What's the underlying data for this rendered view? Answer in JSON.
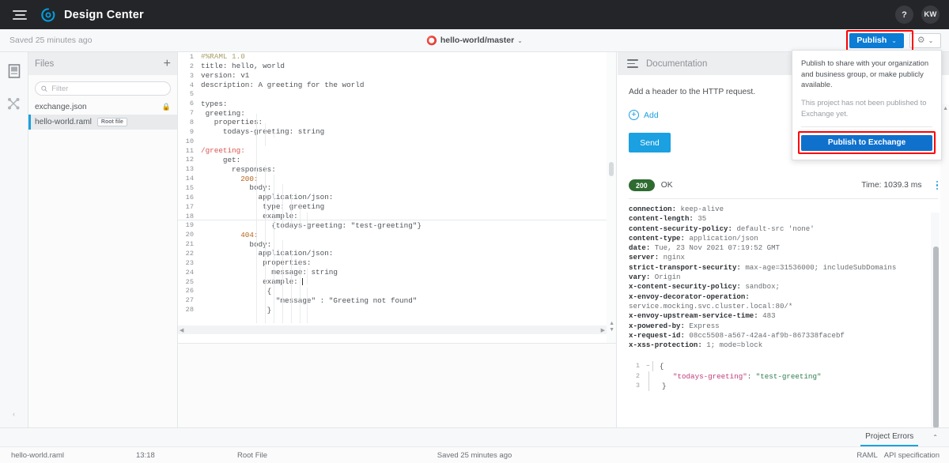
{
  "topnav": {
    "menu_icon": "hamburger-icon",
    "logo_icon": "mulesoft-logo-icon",
    "title": "Design Center",
    "help_label": "?",
    "avatar_label": "KW"
  },
  "toolbar": {
    "saved_text": "Saved 25 minutes ago",
    "branch_icon": "branch-icon",
    "branch_label": "hello-world/master",
    "branch_caret": "⌄",
    "publish_label": "Publish",
    "publish_caret": "⌄",
    "gear_icon": "gear-icon",
    "gear_caret": "⌄",
    "accent_blue": "#0c7cd5",
    "highlight_red": "#ff0000"
  },
  "publish_dropdown": {
    "description": "Publish to share with your organization and business group, or make publicly available.",
    "status_note": "This project has not been published to Exchange yet.",
    "button_label": "Publish to Exchange"
  },
  "rail": {
    "items": [
      {
        "icon": "files-panel-icon",
        "name": "project-files"
      },
      {
        "icon": "api-console-icon",
        "name": "mocking-service"
      }
    ],
    "collapse_label": "‹"
  },
  "files_panel": {
    "title": "Files",
    "add_label": "+",
    "filter_placeholder": "Filter",
    "filter_value": "",
    "search_icon": "search-icon",
    "items": [
      {
        "name": "exchange.json",
        "locked": true,
        "badge": "",
        "active": false
      },
      {
        "name": "hello-world.raml",
        "locked": false,
        "badge": "Root file",
        "active": true
      }
    ]
  },
  "editor": {
    "lines": [
      {
        "n": "1",
        "text": "#%RAML 1.0",
        "cls": "t-com",
        "indent": 0
      },
      {
        "n": "2",
        "text": "title: hello, world",
        "cls": "t-plain",
        "indent": 0
      },
      {
        "n": "3",
        "text": "version: v1",
        "cls": "t-plain",
        "indent": 0
      },
      {
        "n": "4",
        "text": "description: A greeting for the world",
        "cls": "t-plain",
        "indent": 0
      },
      {
        "n": "5",
        "text": "",
        "cls": "t-plain",
        "indent": 0
      },
      {
        "n": "6",
        "text": "types:",
        "cls": "t-plain",
        "indent": 0
      },
      {
        "n": "7",
        "text": " greeting:",
        "cls": "t-plain",
        "indent": 0
      },
      {
        "n": "8",
        "text": "   properties:",
        "cls": "t-plain",
        "indent": 0
      },
      {
        "n": "9",
        "text": "     todays-greeting: string",
        "cls": "t-plain",
        "indent": 0
      },
      {
        "n": "10",
        "text": "",
        "cls": "t-plain",
        "indent": 0
      },
      {
        "n": "11",
        "text": "/greeting:",
        "cls": "t-path",
        "indent": 0
      },
      {
        "n": "12",
        "text": "     get:",
        "cls": "t-plain",
        "indent": 0
      },
      {
        "n": "13",
        "text": "       responses:",
        "cls": "t-plain",
        "indent": 0
      },
      {
        "n": "14",
        "text": "         200:",
        "cls": "t-num",
        "indent": 0
      },
      {
        "n": "15",
        "text": "           body:",
        "cls": "t-plain",
        "indent": 0
      },
      {
        "n": "16",
        "text": "             application/json:",
        "cls": "t-plain",
        "indent": 0
      },
      {
        "n": "17",
        "text": "              type: greeting",
        "cls": "t-plain",
        "indent": 0
      },
      {
        "n": "18",
        "text": "              example:",
        "cls": "t-plain",
        "indent": 0
      },
      {
        "n": "19",
        "text": "                {todays-greeting: \"test-greeting\"}",
        "cls": "t-plain",
        "indent": 0
      },
      {
        "n": "20",
        "text": "         404:",
        "cls": "t-num",
        "indent": 0
      },
      {
        "n": "21",
        "text": "           body:",
        "cls": "t-plain",
        "indent": 0
      },
      {
        "n": "22",
        "text": "             application/json:",
        "cls": "t-plain",
        "indent": 0
      },
      {
        "n": "23",
        "text": "              properties:",
        "cls": "t-plain",
        "indent": 0
      },
      {
        "n": "24",
        "text": "                message: string",
        "cls": "t-plain",
        "indent": 0
      },
      {
        "n": "25",
        "text": "              example: ",
        "cls": "t-plain",
        "indent": 0
      },
      {
        "n": "26",
        "text": "               {",
        "cls": "t-plain",
        "indent": 0
      },
      {
        "n": "27",
        "text": "                 \"message\" : \"Greeting not found\"",
        "cls": "t-plain",
        "indent": 0
      },
      {
        "n": "28",
        "text": "               }",
        "cls": "t-plain",
        "indent": 0
      }
    ],
    "overflow_dots": "• • •"
  },
  "right_panel": {
    "title": "Documentation",
    "header_note": "Add a header to the HTTP request.",
    "add_label": "Add",
    "send_label": "Send",
    "status_code": "200",
    "status_text": "OK",
    "time_label": "Time: 1039.3 ms",
    "response_headers": [
      {
        "key": "connection:",
        "value": "keep-alive"
      },
      {
        "key": "content-length:",
        "value": "35"
      },
      {
        "key": "content-security-policy:",
        "value": "default-src 'none'"
      },
      {
        "key": "content-type:",
        "value": "application/json"
      },
      {
        "key": "date:",
        "value": "Tue, 23 Nov 2021 07:19:52 GMT"
      },
      {
        "key": "server:",
        "value": "nginx"
      },
      {
        "key": "strict-transport-security:",
        "value": "max-age=31536000; includeSubDomains"
      },
      {
        "key": "vary:",
        "value": "Origin"
      },
      {
        "key": "x-content-security-policy:",
        "value": "sandbox;"
      },
      {
        "key": "x-envoy-decorator-operation:",
        "value": ""
      },
      {
        "key": "",
        "value": "service.mocking.svc.cluster.local:80/*"
      },
      {
        "key": "x-envoy-upstream-service-time:",
        "value": "483"
      },
      {
        "key": "x-powered-by:",
        "value": "Express"
      },
      {
        "key": "x-request-id:",
        "value": "08cc5508-a567-42a4-af9b-867338facebf"
      },
      {
        "key": "x-xss-protection:",
        "value": "1; mode=block"
      }
    ],
    "response_body": [
      {
        "n": "1",
        "fold": "−",
        "text": "{",
        "type": "brace"
      },
      {
        "n": "2",
        "fold": "",
        "key": "\"todays-greeting\"",
        "sep": ": ",
        "val": "\"test-greeting\"",
        "type": "pair"
      },
      {
        "n": "3",
        "fold": "",
        "text": "}",
        "type": "brace"
      }
    ],
    "expand_icon": "chevron-right-icon"
  },
  "errorbar": {
    "tab_label": "Project Errors",
    "caret": "⌃"
  },
  "statusbar": {
    "file_name": "hello-world.raml",
    "cursor_pos": "13:18",
    "file_role": "Root File",
    "saved_text": "Saved 25 minutes ago",
    "lang": "RAML",
    "spec": "API specification"
  }
}
